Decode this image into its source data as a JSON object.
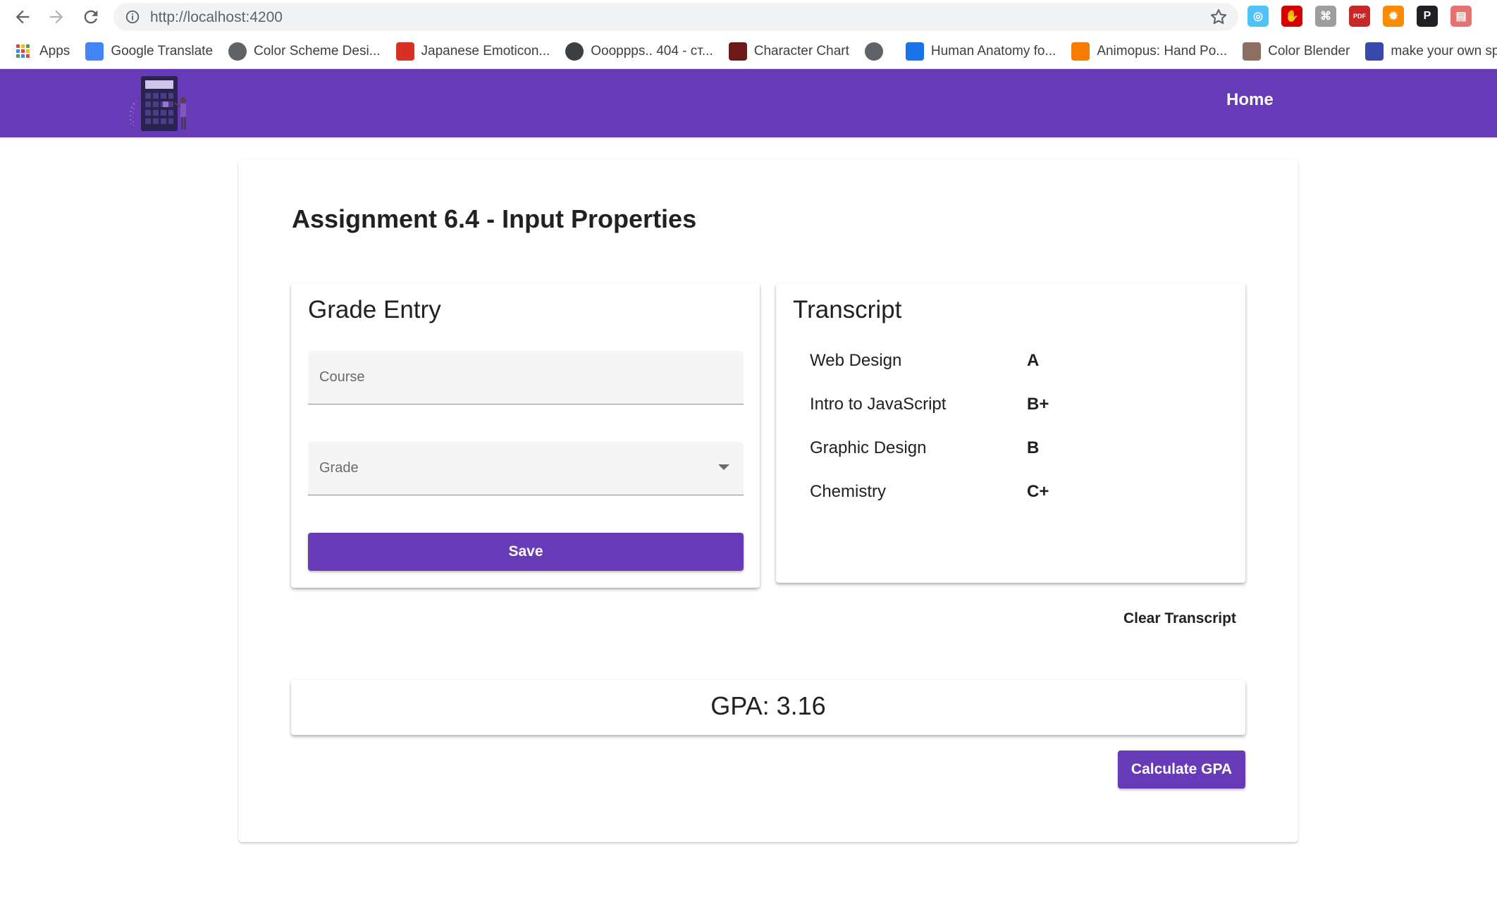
{
  "browser": {
    "url": "http://localhost:4200",
    "bookmarks": [
      {
        "label": "Apps",
        "icon": "apps-grid-icon",
        "color": "#ea4335"
      },
      {
        "label": "Google Translate",
        "icon": "google-translate-icon",
        "color": "#4285f4"
      },
      {
        "label": "Color Scheme Desi...",
        "icon": "color-scheme-icon",
        "color": "#5f6368"
      },
      {
        "label": "Japanese Emoticon...",
        "icon": "japanese-emoticon-icon",
        "color": "#d93025"
      },
      {
        "label": "Oooppps.. 404 - ст...",
        "icon": "hat-icon",
        "color": "#3c4043"
      },
      {
        "label": "Character Chart",
        "icon": "letter-e-icon",
        "color": "#6d1a1a"
      },
      {
        "label": "",
        "icon": "globe-icon",
        "color": "#5f6368"
      },
      {
        "label": "Human Anatomy fo...",
        "icon": "letter-h-icon",
        "color": "#1a73e8"
      },
      {
        "label": "Animopus: Hand Po...",
        "icon": "blogger-icon",
        "color": "#f57c00"
      },
      {
        "label": "Color Blender",
        "icon": "color-blender-icon",
        "color": "#8d6e63"
      },
      {
        "label": "make your own spe...",
        "icon": "wi-icon",
        "color": "#3949ab"
      }
    ],
    "extensions": [
      {
        "name": "extension-a-icon",
        "color": "#4fc3f7",
        "glyph": "◎"
      },
      {
        "name": "adblock-icon",
        "color": "#d50000",
        "glyph": "✋"
      },
      {
        "name": "extension-b-icon",
        "color": "#9e9e9e",
        "glyph": "⌘"
      },
      {
        "name": "pdf-icon",
        "color": "#c62828",
        "glyph": "PDF"
      },
      {
        "name": "extension-c-icon",
        "color": "#fb8c00",
        "glyph": "✹"
      },
      {
        "name": "extension-p-icon",
        "color": "#202124",
        "glyph": "P"
      },
      {
        "name": "extension-d-icon",
        "color": "#e57373",
        "glyph": "▤"
      }
    ]
  },
  "app": {
    "nav_home": "Home",
    "brand_color": "#673ab7"
  },
  "page": {
    "title": "Assignment 6.4 - Input Properties"
  },
  "grade_entry": {
    "title": "Grade Entry",
    "course_placeholder": "Course",
    "grade_placeholder": "Grade",
    "save_label": "Save"
  },
  "transcript": {
    "title": "Transcript",
    "entries": [
      {
        "course": "Web Design",
        "grade": "A"
      },
      {
        "course": "Intro to JavaScript",
        "grade": "B+"
      },
      {
        "course": "Graphic Design",
        "grade": "B"
      },
      {
        "course": "Chemistry",
        "grade": "C+"
      }
    ],
    "clear_label": "Clear Transcript"
  },
  "gpa": {
    "text": "GPA: 3.16",
    "calculate_label": "Calculate GPA"
  }
}
